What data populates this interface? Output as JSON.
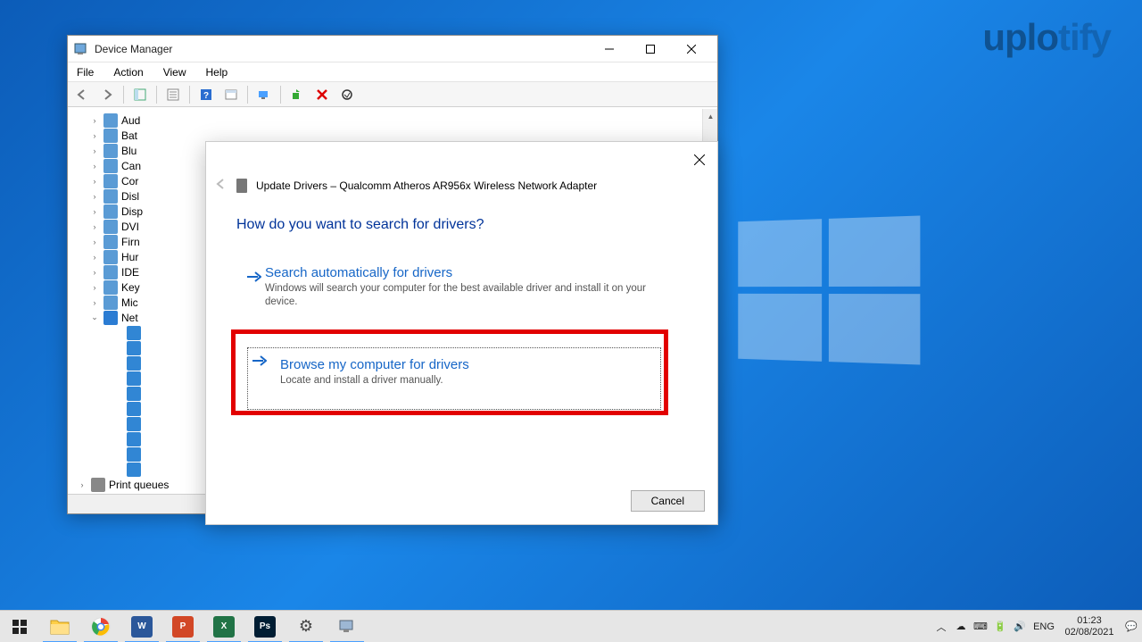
{
  "watermark": {
    "p1": "uplo",
    "p2": "tify"
  },
  "window": {
    "title": "Device Manager",
    "menu": [
      "File",
      "Action",
      "View",
      "Help"
    ]
  },
  "tree": {
    "items": [
      {
        "label": "Aud",
        "chev": ">"
      },
      {
        "label": "Bat",
        "chev": ">"
      },
      {
        "label": "Blu",
        "chev": ">"
      },
      {
        "label": "Can",
        "chev": ">"
      },
      {
        "label": "Cor",
        "chev": ">"
      },
      {
        "label": "Disl",
        "chev": ">"
      },
      {
        "label": "Disp",
        "chev": ">"
      },
      {
        "label": "DVI",
        "chev": ">"
      },
      {
        "label": "Firn",
        "chev": ">"
      },
      {
        "label": "Hur",
        "chev": ">"
      },
      {
        "label": "IDE",
        "chev": ">"
      },
      {
        "label": "Key",
        "chev": ">"
      },
      {
        "label": "Mic",
        "chev": ">"
      },
      {
        "label": "Net",
        "chev": "v"
      }
    ],
    "last": "Print queues"
  },
  "dialog": {
    "title": "Update Drivers – Qualcomm Atheros AR956x Wireless Network Adapter",
    "headline": "How do you want to search for drivers?",
    "opt1": {
      "title": "Search automatically for drivers",
      "desc": "Windows will search your computer for the best available driver and install it on your device."
    },
    "opt2": {
      "title": "Browse my computer for drivers",
      "desc": "Locate and install a driver manually."
    },
    "cancel": "Cancel"
  },
  "taskbar": {
    "apps": [
      {
        "name": "file-explorer",
        "bg": "#ffcf48",
        "txt": ""
      },
      {
        "name": "chrome",
        "bg": "#ffffff",
        "txt": ""
      },
      {
        "name": "word",
        "bg": "#2b579a",
        "txt": "W"
      },
      {
        "name": "powerpoint",
        "bg": "#d24726",
        "txt": "P"
      },
      {
        "name": "excel",
        "bg": "#217346",
        "txt": "X"
      },
      {
        "name": "photoshop",
        "bg": "#001d33",
        "txt": "Ps"
      },
      {
        "name": "settings",
        "bg": "#dcdcdc",
        "txt": "⚙"
      },
      {
        "name": "device-manager",
        "bg": "#dcdcdc",
        "txt": ""
      }
    ],
    "lang": "ENG",
    "time": "01:23",
    "date": "02/08/2021"
  }
}
